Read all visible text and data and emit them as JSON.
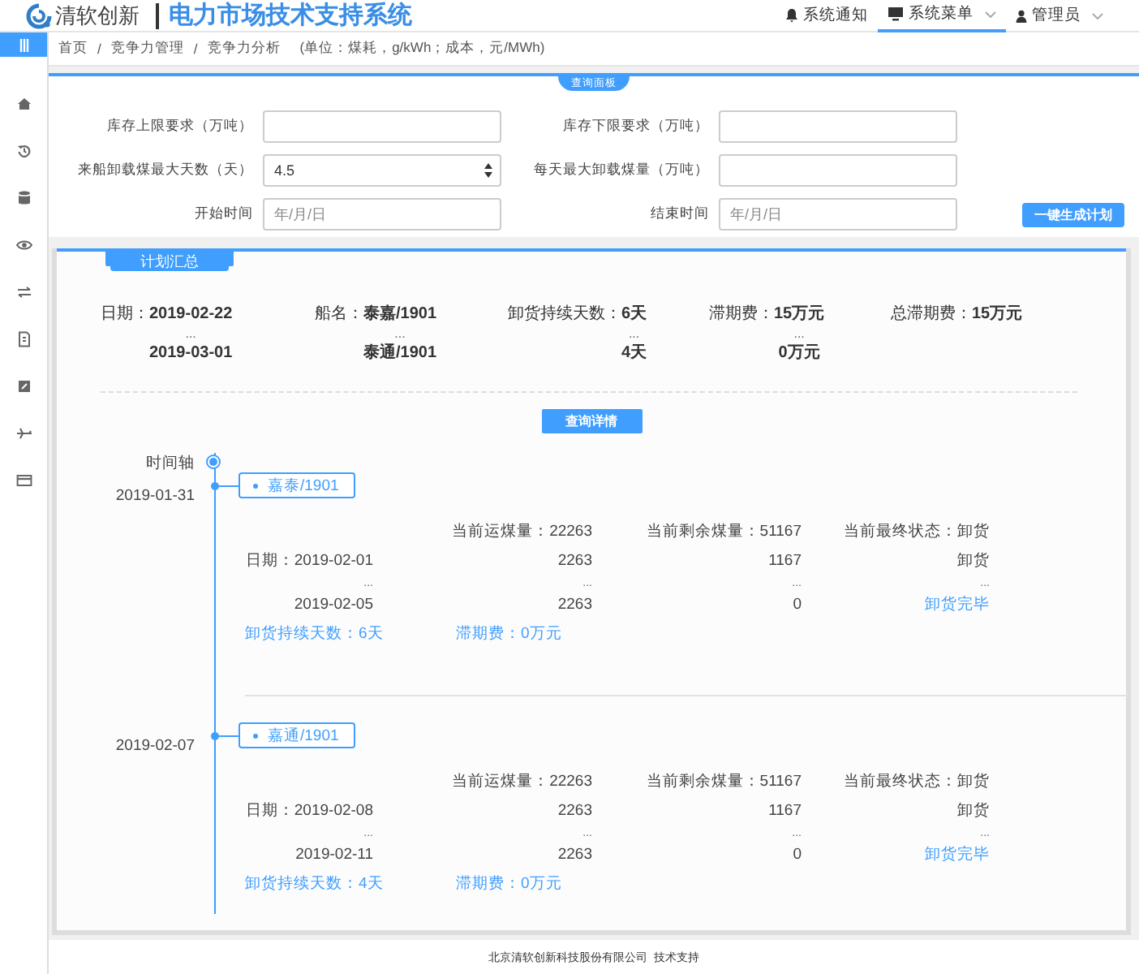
{
  "header": {
    "logo_text": "清软创新",
    "title": "电力市场技术支持系统",
    "nav": [
      {
        "label": "系统通知",
        "kind": "bell",
        "selected": false,
        "dropdown": false
      },
      {
        "label": "系统菜单",
        "kind": "monitor",
        "selected": true,
        "dropdown": true
      },
      {
        "label": "管理员",
        "kind": "user",
        "selected": false,
        "dropdown": true
      }
    ]
  },
  "sidebar": {
    "items": [
      {
        "kind": "menu",
        "selected": true
      },
      {
        "kind": "home",
        "selected": false
      },
      {
        "kind": "history",
        "selected": false
      },
      {
        "kind": "database",
        "selected": false
      },
      {
        "kind": "eye",
        "selected": false
      },
      {
        "kind": "transfer",
        "selected": false
      },
      {
        "kind": "document",
        "selected": false
      },
      {
        "kind": "edit",
        "selected": false
      },
      {
        "kind": "plane",
        "selected": false
      },
      {
        "kind": "card",
        "selected": false
      }
    ]
  },
  "breadcrumb": {
    "items": [
      "首页",
      "竞争力管理",
      "竞争力分析"
    ],
    "separator": "/",
    "note": "(单位：煤耗，g/kWh；成本，元/MWh)"
  },
  "query_panel": {
    "title": "查询面板",
    "fields": [
      {
        "label": "库存上限要求（万吨）",
        "kind": "text"
      },
      {
        "label": "库存下限要求（万吨）",
        "kind": "text"
      },
      {
        "label": "来船卸载煤最大天数（天）",
        "kind": "number",
        "value": "4.5"
      },
      {
        "label": "每天最大卸载煤量（万吨）",
        "kind": "text"
      },
      {
        "label": "开始时间",
        "kind": "date",
        "placeholder": "年/月/日"
      },
      {
        "label": "结束时间",
        "kind": "date",
        "placeholder": "年/月/日"
      }
    ],
    "button": "一键生成计划"
  },
  "summary": {
    "tab": "计划汇总",
    "columns": [
      {
        "label": "日期：",
        "values": [
          "2019-02-22",
          "...",
          "2019-03-01"
        ]
      },
      {
        "label": "船名：",
        "values": [
          "泰嘉/1901",
          "...",
          "泰通/1901"
        ]
      },
      {
        "label": "卸货持续天数：",
        "values": [
          "6天",
          "...",
          "4天"
        ]
      },
      {
        "label": "滞期费：",
        "values": [
          "15万元",
          "...",
          "0万元"
        ]
      },
      {
        "label": "总滞期费：",
        "values": [
          "15万元"
        ]
      }
    ],
    "button": "查询详情"
  },
  "timeline": {
    "label": "时间轴",
    "entries": [
      {
        "date": "2019-01-31",
        "ship": "嘉泰/1901",
        "header": [
          "当前运煤量：22263",
          "当前剩余煤量：51167",
          "当前最终状态：卸货"
        ],
        "rows": [
          {
            "kind": "data",
            "cells": [
              "日期：2019-02-01",
              "2263",
              "1167",
              "卸货"
            ]
          },
          {
            "kind": "ellipsis",
            "cells": [
              "...",
              "...",
              "...",
              "..."
            ]
          },
          {
            "kind": "final",
            "cells": [
              "2019-02-05",
              "2263",
              "0",
              "卸货完毕"
            ]
          }
        ],
        "footer": [
          "卸货持续天数：6天",
          "滞期费：0万元"
        ]
      },
      {
        "date": "2019-02-07",
        "ship": "嘉通/1901",
        "header": [
          "当前运煤量：22263",
          "当前剩余煤量：51167",
          "当前最终状态：卸货"
        ],
        "rows": [
          {
            "kind": "data",
            "cells": [
              "日期：2019-02-08",
              "2263",
              "1167",
              "卸货"
            ]
          },
          {
            "kind": "ellipsis",
            "cells": [
              "...",
              "...",
              "...",
              "..."
            ]
          },
          {
            "kind": "final",
            "cells": [
              "2019-02-11",
              "2263",
              "0",
              "卸货完毕"
            ]
          }
        ],
        "footer": [
          "卸货持续天数：4天",
          "滞期费：0万元"
        ]
      }
    ]
  },
  "footer": "北京清软创新科技股份有限公司  技术支持"
}
